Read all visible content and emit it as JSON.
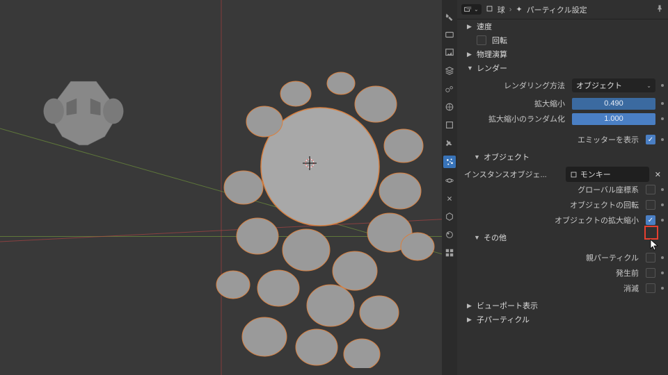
{
  "header": {
    "object_name": "球",
    "settings_name": "パーティクル設定"
  },
  "panels": {
    "velocity": "速度",
    "rotation": "回転",
    "physics": "物理演算",
    "render": "レンダー",
    "object": "オブジェクト",
    "misc": "その他",
    "viewport": "ビューポート表示",
    "children": "子パーティクル"
  },
  "render": {
    "method_label": "レンダリング方法",
    "method_value": "オブジェクト",
    "scale_label": "拡大縮小",
    "scale_value": "0.490",
    "scale_random_label": "拡大縮小のランダム化",
    "scale_random_value": "1.000",
    "show_emitter_label": "エミッターを表示"
  },
  "object": {
    "instance_label": "インスタンスオブジェ...",
    "instance_value": "モンキー",
    "global_label": "グローバル座標系",
    "rotation_label": "オブジェクトの回転",
    "scale_label": "オブジェクトの拡大縮小"
  },
  "misc": {
    "parent_label": "親パーティクル",
    "unborn_label": "発生前",
    "dead_label": "消滅"
  }
}
